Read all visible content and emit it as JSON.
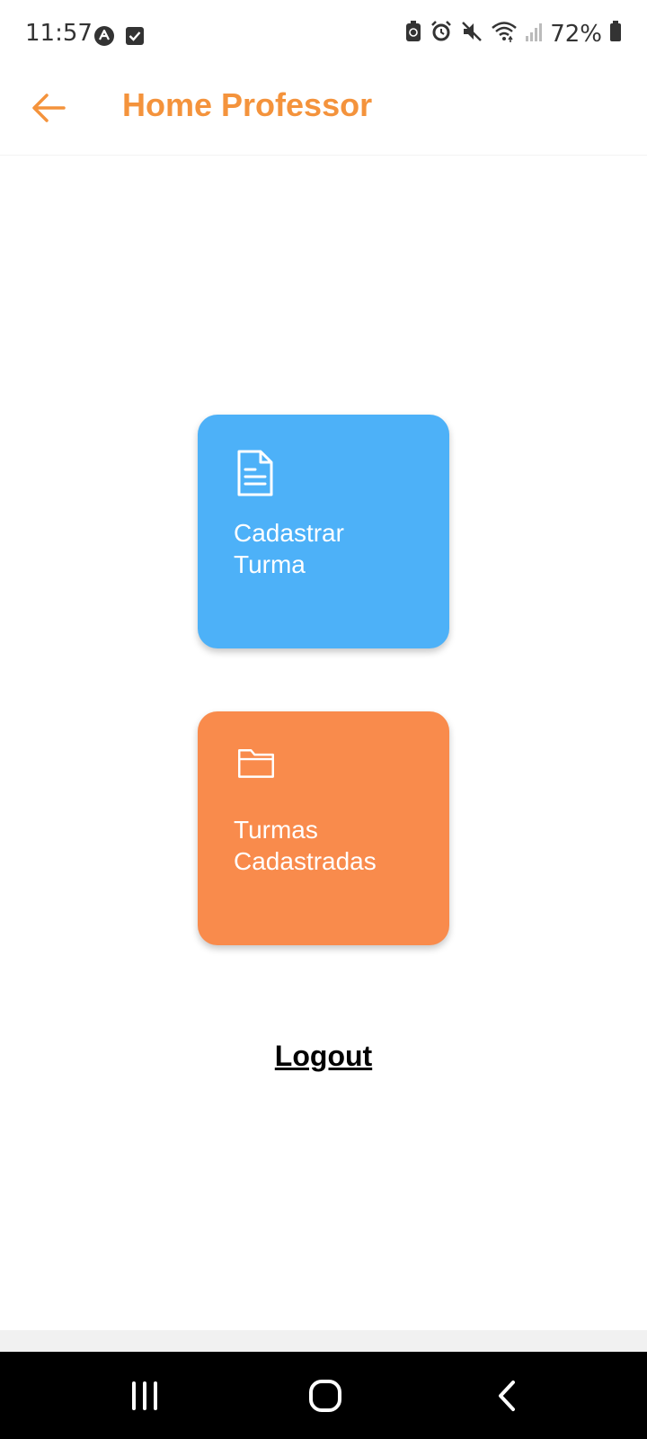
{
  "status_bar": {
    "time": "11:57",
    "battery_percent": "72%",
    "left_icons": [
      "app-notification-icon",
      "check-notification-icon"
    ],
    "right_icons": [
      "battery-saver-icon",
      "alarm-icon",
      "mute-icon",
      "wifi-icon",
      "signal-icon",
      "battery-icon"
    ]
  },
  "app_bar": {
    "title": "Home Professor",
    "back_icon": "arrow-left-icon"
  },
  "cards": [
    {
      "icon": "document-icon",
      "label_line1": "Cadastrar",
      "label_line2": "Turma",
      "color": "#4db1f8"
    },
    {
      "icon": "folder-icon",
      "label_line1": "Turmas",
      "label_line2": "Cadastradas",
      "color": "#f98b4c"
    }
  ],
  "logout": {
    "label": "Logout"
  },
  "nav_bar": {
    "icons": [
      "recents-icon",
      "home-icon",
      "back-nav-icon"
    ]
  },
  "colors": {
    "accent": "#f4933c"
  }
}
